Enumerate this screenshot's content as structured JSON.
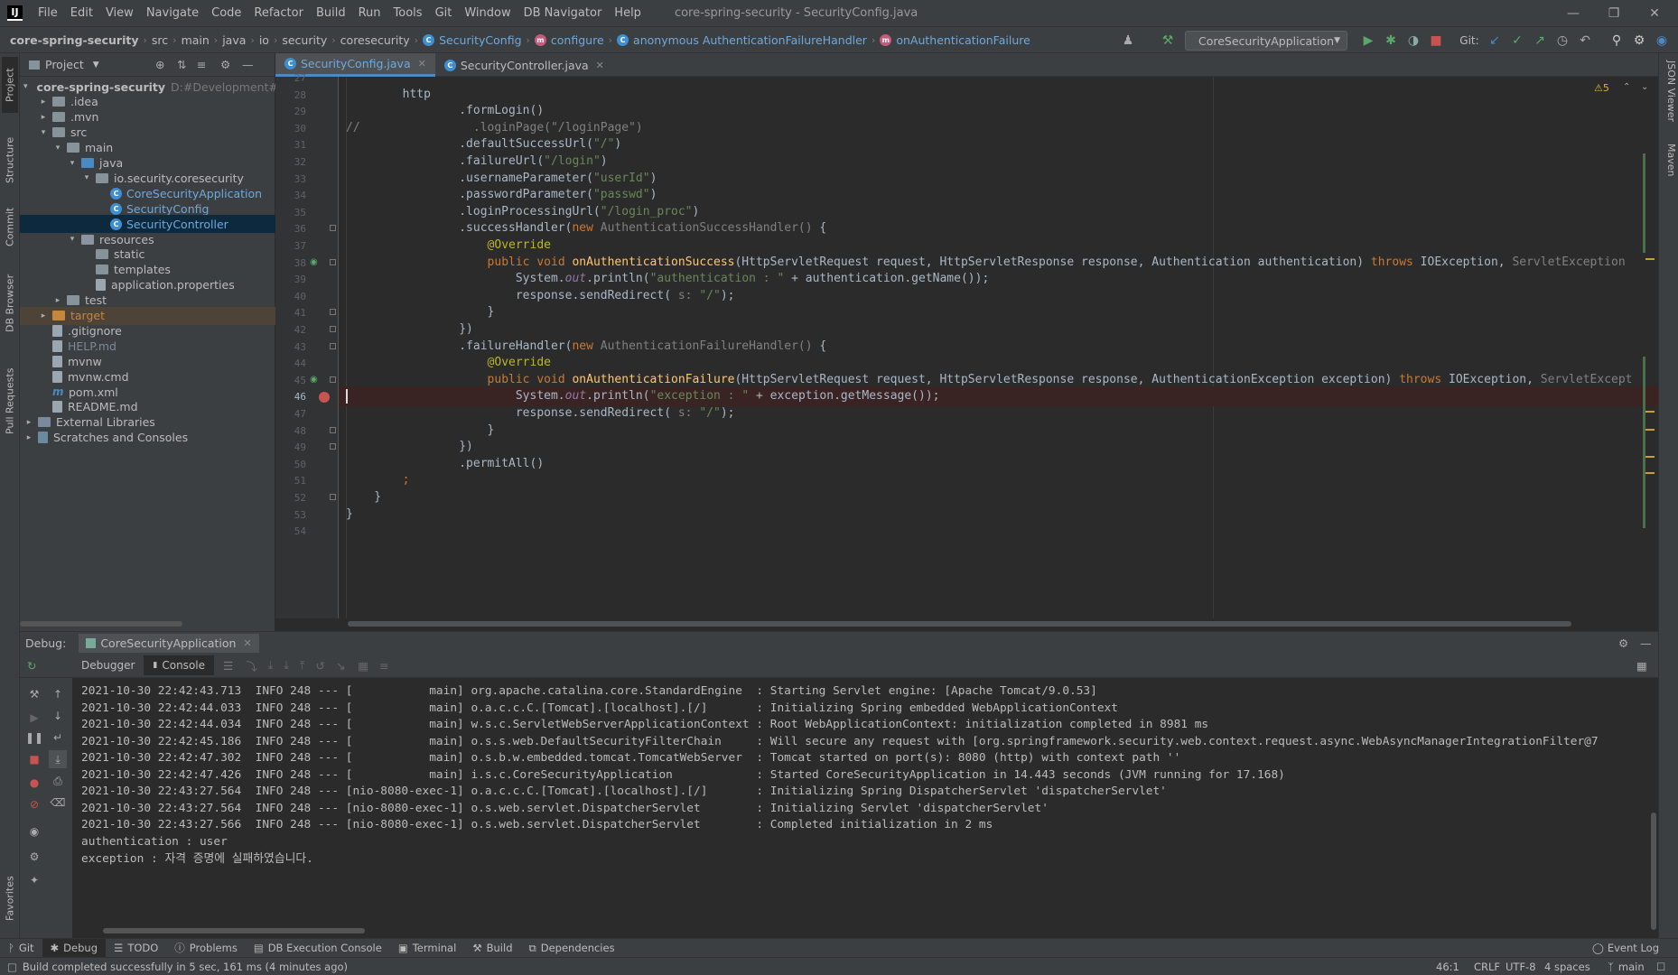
{
  "app": {
    "logo": "IJ",
    "window_title": "core-spring-security - SecurityConfig.java"
  },
  "menu": [
    "File",
    "Edit",
    "View",
    "Navigate",
    "Code",
    "Refactor",
    "Build",
    "Run",
    "Tools",
    "Git",
    "Window",
    "DB Navigator",
    "Help"
  ],
  "breadcrumb": [
    "core-spring-security",
    "src",
    "main",
    "java",
    "io",
    "security",
    "coresecurity",
    "SecurityConfig",
    "configure",
    "anonymous AuthenticationFailureHandler",
    "onAuthenticationFailure"
  ],
  "toolbar": {
    "run_config": "CoreSecurityApplication",
    "git_label": "Git:"
  },
  "project": {
    "header": "Project",
    "tree": [
      {
        "label": "core-spring-security",
        "hint": "D:#Development#Git",
        "depth": 0,
        "arrow": "down",
        "type": "root"
      },
      {
        "label": ".idea",
        "depth": 1,
        "arrow": "right",
        "type": "folder"
      },
      {
        "label": ".mvn",
        "depth": 1,
        "arrow": "right",
        "type": "folder"
      },
      {
        "label": "src",
        "depth": 1,
        "arrow": "down",
        "type": "folder"
      },
      {
        "label": "main",
        "depth": 2,
        "arrow": "down",
        "type": "folder"
      },
      {
        "label": "java",
        "depth": 3,
        "arrow": "down",
        "type": "src"
      },
      {
        "label": "io.security.coresecurity",
        "depth": 4,
        "arrow": "down",
        "type": "pkg"
      },
      {
        "label": "CoreSecurityApplication",
        "depth": 5,
        "arrow": "",
        "type": "class"
      },
      {
        "label": "SecurityConfig",
        "depth": 5,
        "arrow": "",
        "type": "class"
      },
      {
        "label": "SecurityController",
        "depth": 5,
        "arrow": "",
        "type": "class",
        "selected": true
      },
      {
        "label": "resources",
        "depth": 3,
        "arrow": "down",
        "type": "res"
      },
      {
        "label": "static",
        "depth": 4,
        "arrow": "",
        "type": "folder"
      },
      {
        "label": "templates",
        "depth": 4,
        "arrow": "",
        "type": "folder"
      },
      {
        "label": "application.properties",
        "depth": 4,
        "arrow": "",
        "type": "file"
      },
      {
        "label": "test",
        "depth": 2,
        "arrow": "right",
        "type": "folder"
      },
      {
        "label": "target",
        "depth": 1,
        "arrow": "right",
        "type": "excl"
      },
      {
        "label": ".gitignore",
        "depth": 1,
        "arrow": "",
        "type": "file"
      },
      {
        "label": "HELP.md",
        "depth": 1,
        "arrow": "",
        "type": "file"
      },
      {
        "label": "mvnw",
        "depth": 1,
        "arrow": "",
        "type": "file"
      },
      {
        "label": "mvnw.cmd",
        "depth": 1,
        "arrow": "",
        "type": "file"
      },
      {
        "label": "pom.xml",
        "depth": 1,
        "arrow": "",
        "type": "maven"
      },
      {
        "label": "README.md",
        "depth": 1,
        "arrow": "",
        "type": "file"
      },
      {
        "label": "External Libraries",
        "depth": 0,
        "arrow": "right",
        "type": "lib"
      },
      {
        "label": "Scratches and Consoles",
        "depth": 0,
        "arrow": "right",
        "type": "scratch"
      }
    ]
  },
  "left_strip": [
    "Project",
    "Structure",
    "Commit",
    "DB Browser",
    "Pull Requests",
    "Favorites"
  ],
  "right_strip": [
    "JSON Viewer",
    "Maven"
  ],
  "editor": {
    "tabs": [
      {
        "label": "SecurityConfig.java",
        "active": true
      },
      {
        "label": "SecurityController.java",
        "active": false
      }
    ],
    "warnings": "5",
    "lines": [
      {
        "n": "27",
        "html": ""
      },
      {
        "n": "28",
        "html": "        http"
      },
      {
        "n": "29",
        "html": "                .formLogin()"
      },
      {
        "n": "30",
        "html": "<span class=\"cm\">//                .loginPage(\"/loginPage\")</span>"
      },
      {
        "n": "31",
        "html": "                .defaultSuccessUrl(<span class=\"str\">\"/\"</span>)"
      },
      {
        "n": "32",
        "html": "                .failureUrl(<span class=\"str\">\"/login\"</span>)"
      },
      {
        "n": "33",
        "html": "                .usernameParameter(<span class=\"str\">\"userId\"</span>)"
      },
      {
        "n": "34",
        "html": "                .passwordParameter(<span class=\"str\">\"passwd\"</span>)"
      },
      {
        "n": "35",
        "html": "                .loginProcessingUrl(<span class=\"str\">\"/login_proc\"</span>)"
      },
      {
        "n": "36",
        "html": "                .successHandler(<span class=\"kw\">new</span> <span class=\"gr\">AuthenticationSuccessHandler()</span> {"
      },
      {
        "n": "37",
        "html": "                    <span class=\"ann\">@Override</span>"
      },
      {
        "n": "38",
        "html": "                    <span class=\"kw\">public void</span> <span class=\"fn\">onAuthenticationSuccess</span>(HttpServletRequest request, HttpServletResponse response, Authentication authentication) <span class=\"kw\">throws</span> IOException, <span class=\"gr\">ServletException</span>"
      },
      {
        "n": "39",
        "html": "                        System.<span class=\"it\">out</span>.println(<span class=\"str\">\"authentication : \"</span> + authentication.getName());"
      },
      {
        "n": "40",
        "html": "                        response.sendRedirect( <span class=\"gr\">s:</span> <span class=\"str\">\"/\"</span>);"
      },
      {
        "n": "41",
        "html": "                    }"
      },
      {
        "n": "42",
        "html": "                })"
      },
      {
        "n": "43",
        "html": "                .failureHandler(<span class=\"kw\">new</span> <span class=\"gr\">AuthenticationFailureHandler()</span> {"
      },
      {
        "n": "44",
        "html": "                    <span class=\"ann\">@Override</span>"
      },
      {
        "n": "45",
        "html": "                    <span class=\"kw\">public void</span> <span class=\"fn\">onAuthenticationFailure</span>(HttpServletRequest request, HttpServletResponse response, AuthenticationException exception) <span class=\"kw\">throws</span> IOException, <span class=\"gr\">ServletExcept</span>"
      },
      {
        "n": "46",
        "html": "                        System.<span class=\"it\">out</span>.println(<span class=\"str\">\"exception : \"</span> + exception.getMessage());",
        "bp": true
      },
      {
        "n": "47",
        "html": "                        response.sendRedirect( <span class=\"gr\">s:</span> <span class=\"str\">\"/\"</span>);"
      },
      {
        "n": "48",
        "html": "                    }"
      },
      {
        "n": "49",
        "html": "                })"
      },
      {
        "n": "50",
        "html": "                .permitAll()"
      },
      {
        "n": "51",
        "html": "        <span class=\"kw\">;</span>"
      },
      {
        "n": "52",
        "html": "    }"
      },
      {
        "n": "53",
        "html": "}"
      },
      {
        "n": "54",
        "html": ""
      }
    ]
  },
  "debug": {
    "title": "Debug:",
    "session": "CoreSecurityApplication",
    "tabs": [
      "Debugger",
      "Console"
    ],
    "log": [
      "2021-10-30 22:42:43.713  INFO 248 --- [           main] org.apache.catalina.core.StandardEngine  : Starting Servlet engine: [Apache Tomcat/9.0.53]",
      "2021-10-30 22:42:44.033  INFO 248 --- [           main] o.a.c.c.C.[Tomcat].[localhost].[/]       : Initializing Spring embedded WebApplicationContext",
      "2021-10-30 22:42:44.034  INFO 248 --- [           main] w.s.c.ServletWebServerApplicationContext : Root WebApplicationContext: initialization completed in 8981 ms",
      "2021-10-30 22:42:45.186  INFO 248 --- [           main] o.s.s.web.DefaultSecurityFilterChain     : Will secure any request with [org.springframework.security.web.context.request.async.WebAsyncManagerIntegrationFilter@7",
      "2021-10-30 22:42:47.302  INFO 248 --- [           main] o.s.b.w.embedded.tomcat.TomcatWebServer  : Tomcat started on port(s): 8080 (http) with context path ''",
      "2021-10-30 22:42:47.426  INFO 248 --- [           main] i.s.c.CoreSecurityApplication            : Started CoreSecurityApplication in 14.443 seconds (JVM running for 17.168)",
      "2021-10-30 22:43:27.564  INFO 248 --- [nio-8080-exec-1] o.a.c.c.C.[Tomcat].[localhost].[/]       : Initializing Spring DispatcherServlet 'dispatcherServlet'",
      "2021-10-30 22:43:27.564  INFO 248 --- [nio-8080-exec-1] o.s.web.servlet.DispatcherServlet        : Initializing Servlet 'dispatcherServlet'",
      "2021-10-30 22:43:27.566  INFO 248 --- [nio-8080-exec-1] o.s.web.servlet.DispatcherServlet        : Completed initialization in 2 ms",
      "authentication : user",
      "exception : 자격 증명에 실패하였습니다."
    ]
  },
  "tool_windows": [
    "Git",
    "Debug",
    "TODO",
    "Problems",
    "DB Execution Console",
    "Terminal",
    "Build",
    "Dependencies"
  ],
  "event_log": "Event Log",
  "status": {
    "message": "Build completed successfully in 5 sec, 161 ms (4 minutes ago)",
    "position": "46:1",
    "line_sep": "CRLF",
    "encoding": "UTF-8",
    "indent": "4 spaces",
    "branch": "main"
  },
  "colors": {
    "accent": "#4a88c7",
    "selection": "#0d293e",
    "breakpoint": "#c75450"
  }
}
